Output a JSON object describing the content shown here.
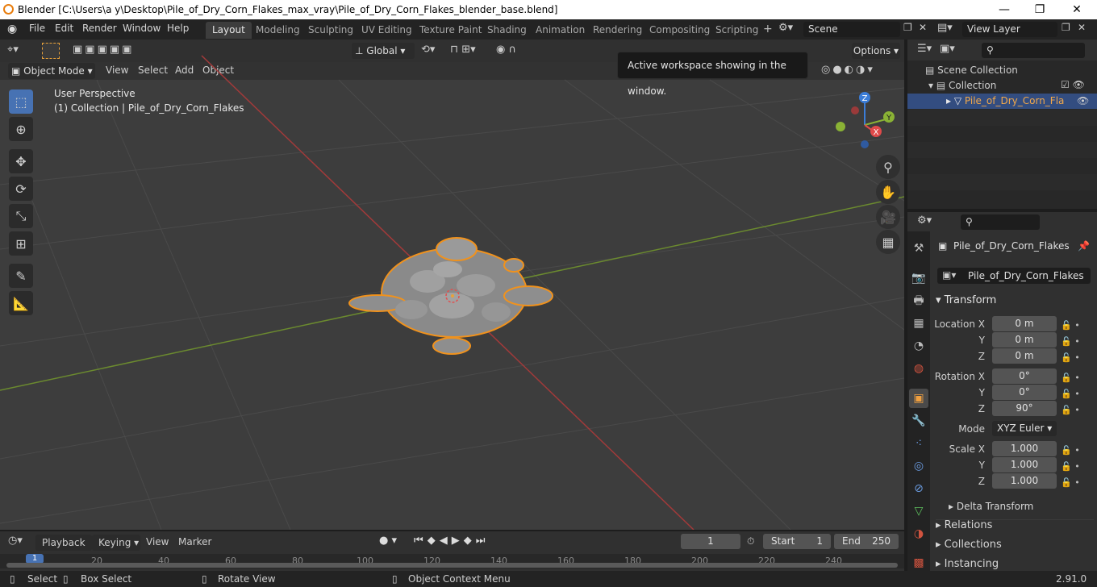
{
  "window": {
    "title": "Blender [C:\\Users\\a y\\Desktop\\Pile_of_Dry_Corn_Flakes_max_vray\\Pile_of_Dry_Corn_Flakes_blender_base.blend]",
    "min": "—",
    "max": "❐",
    "close": "✕"
  },
  "menu": [
    "File",
    "Edit",
    "Render",
    "Window",
    "Help"
  ],
  "workspaces": [
    "Layout",
    "Modeling",
    "Sculpting",
    "UV Editing",
    "Texture Paint",
    "Shading",
    "Animation",
    "Rendering",
    "Compositing",
    "Scripting"
  ],
  "scene": {
    "name": "Scene",
    "view_layer": "View Layer"
  },
  "tooltip": "Active workspace showing in the window.",
  "viewport": {
    "mode": "Object Mode",
    "menus": [
      "View",
      "Select",
      "Add",
      "Object"
    ],
    "orientation": "Global",
    "options": "Options",
    "info_line1": "User Perspective",
    "info_line2": "(1) Collection | Pile_of_Dry_Corn_Flakes",
    "gizmo": {
      "x": "X",
      "y": "Y",
      "z": "Z"
    }
  },
  "outliner": {
    "scene_collection": "Scene Collection",
    "collection": "Collection",
    "object": "Pile_of_Dry_Corn_Fla"
  },
  "properties": {
    "object_name": "Pile_of_Dry_Corn_Flakes",
    "object_field": "Pile_of_Dry_Corn_Flakes",
    "transform_header": "Transform",
    "location_label": "Location X",
    "y_label": "Y",
    "z_label": "Z",
    "rotation_label": "Rotation X",
    "scale_label": "Scale X",
    "mode_label": "Mode",
    "mode_value": "XYZ Euler",
    "loc": [
      "0 m",
      "0 m",
      "0 m"
    ],
    "rot": [
      "0°",
      "0°",
      "90°"
    ],
    "scale": [
      "1.000",
      "1.000",
      "1.000"
    ],
    "delta": "Delta Transform",
    "relations": "Relations",
    "collections": "Collections",
    "instancing": "Instancing"
  },
  "timeline": {
    "menus": [
      "Playback",
      "Keying",
      "View",
      "Marker"
    ],
    "current_frame": "1",
    "start_label": "Start",
    "start": "1",
    "end_label": "End",
    "end": "250",
    "ruler": [
      "1",
      "20",
      "40",
      "60",
      "80",
      "100",
      "120",
      "140",
      "160",
      "180",
      "200",
      "220",
      "240"
    ]
  },
  "status": {
    "select": "Select",
    "box_select": "Box Select",
    "rotate": "Rotate View",
    "context": "Object Context Menu",
    "version": "2.91.0"
  }
}
